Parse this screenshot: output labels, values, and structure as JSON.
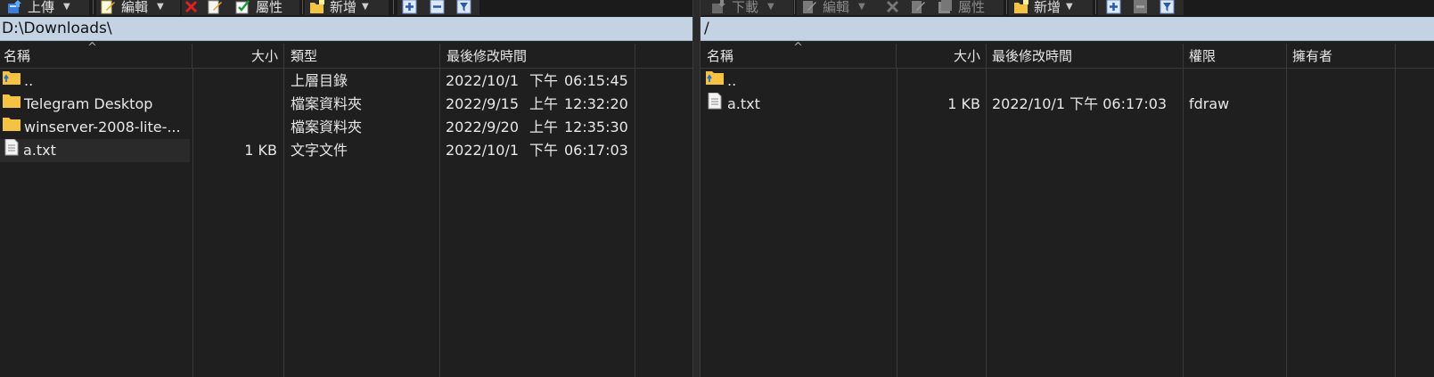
{
  "left": {
    "toolbar": {
      "upload": "上傳",
      "edit": "編輯",
      "properties": "屬性",
      "new": "新增"
    },
    "path": "D:\\Downloads\\",
    "columns": {
      "name": "名稱",
      "size": "大小",
      "type": "類型",
      "modified": "最後修改時間"
    },
    "rows": [
      {
        "name": "..",
        "size": "",
        "type": "上層目錄",
        "date": "2022/10/1",
        "ampm": "下午",
        "time": "06:15:45",
        "icon": "parent-folder-icon"
      },
      {
        "name": "Telegram Desktop",
        "size": "",
        "type": "檔案資料夾",
        "date": "2022/9/15",
        "ampm": "上午",
        "time": "12:32:20",
        "icon": "folder-icon"
      },
      {
        "name": "winserver-2008-lite-...",
        "size": "",
        "type": "檔案資料夾",
        "date": "2022/9/20",
        "ampm": "上午",
        "time": "12:35:30",
        "icon": "folder-icon"
      },
      {
        "name": "a.txt",
        "size": "1 KB",
        "type": "文字文件",
        "date": "2022/10/1",
        "ampm": "下午",
        "time": "06:17:03",
        "icon": "text-file-icon"
      }
    ]
  },
  "right": {
    "toolbar": {
      "download": "下載",
      "edit": "編輯",
      "properties": "屬性",
      "new": "新增"
    },
    "path": "/",
    "columns": {
      "name": "名稱",
      "size": "大小",
      "modified": "最後修改時間",
      "permissions": "權限",
      "owner": "擁有者"
    },
    "rows": [
      {
        "name": "..",
        "size": "",
        "modified": "",
        "permissions": "",
        "owner": "",
        "icon": "parent-folder-icon"
      },
      {
        "name": "a.txt",
        "size": "1 KB",
        "modified": "2022/10/1 下午 06:17:03",
        "permissions": "fdraw",
        "owner": "",
        "icon": "text-file-icon"
      }
    ]
  },
  "colors": {
    "background": "#1f1f1f",
    "pathbar": "#c3d3e3",
    "text": "#e8e8e8",
    "folder": "#f4c343",
    "delete": "#e02020"
  }
}
